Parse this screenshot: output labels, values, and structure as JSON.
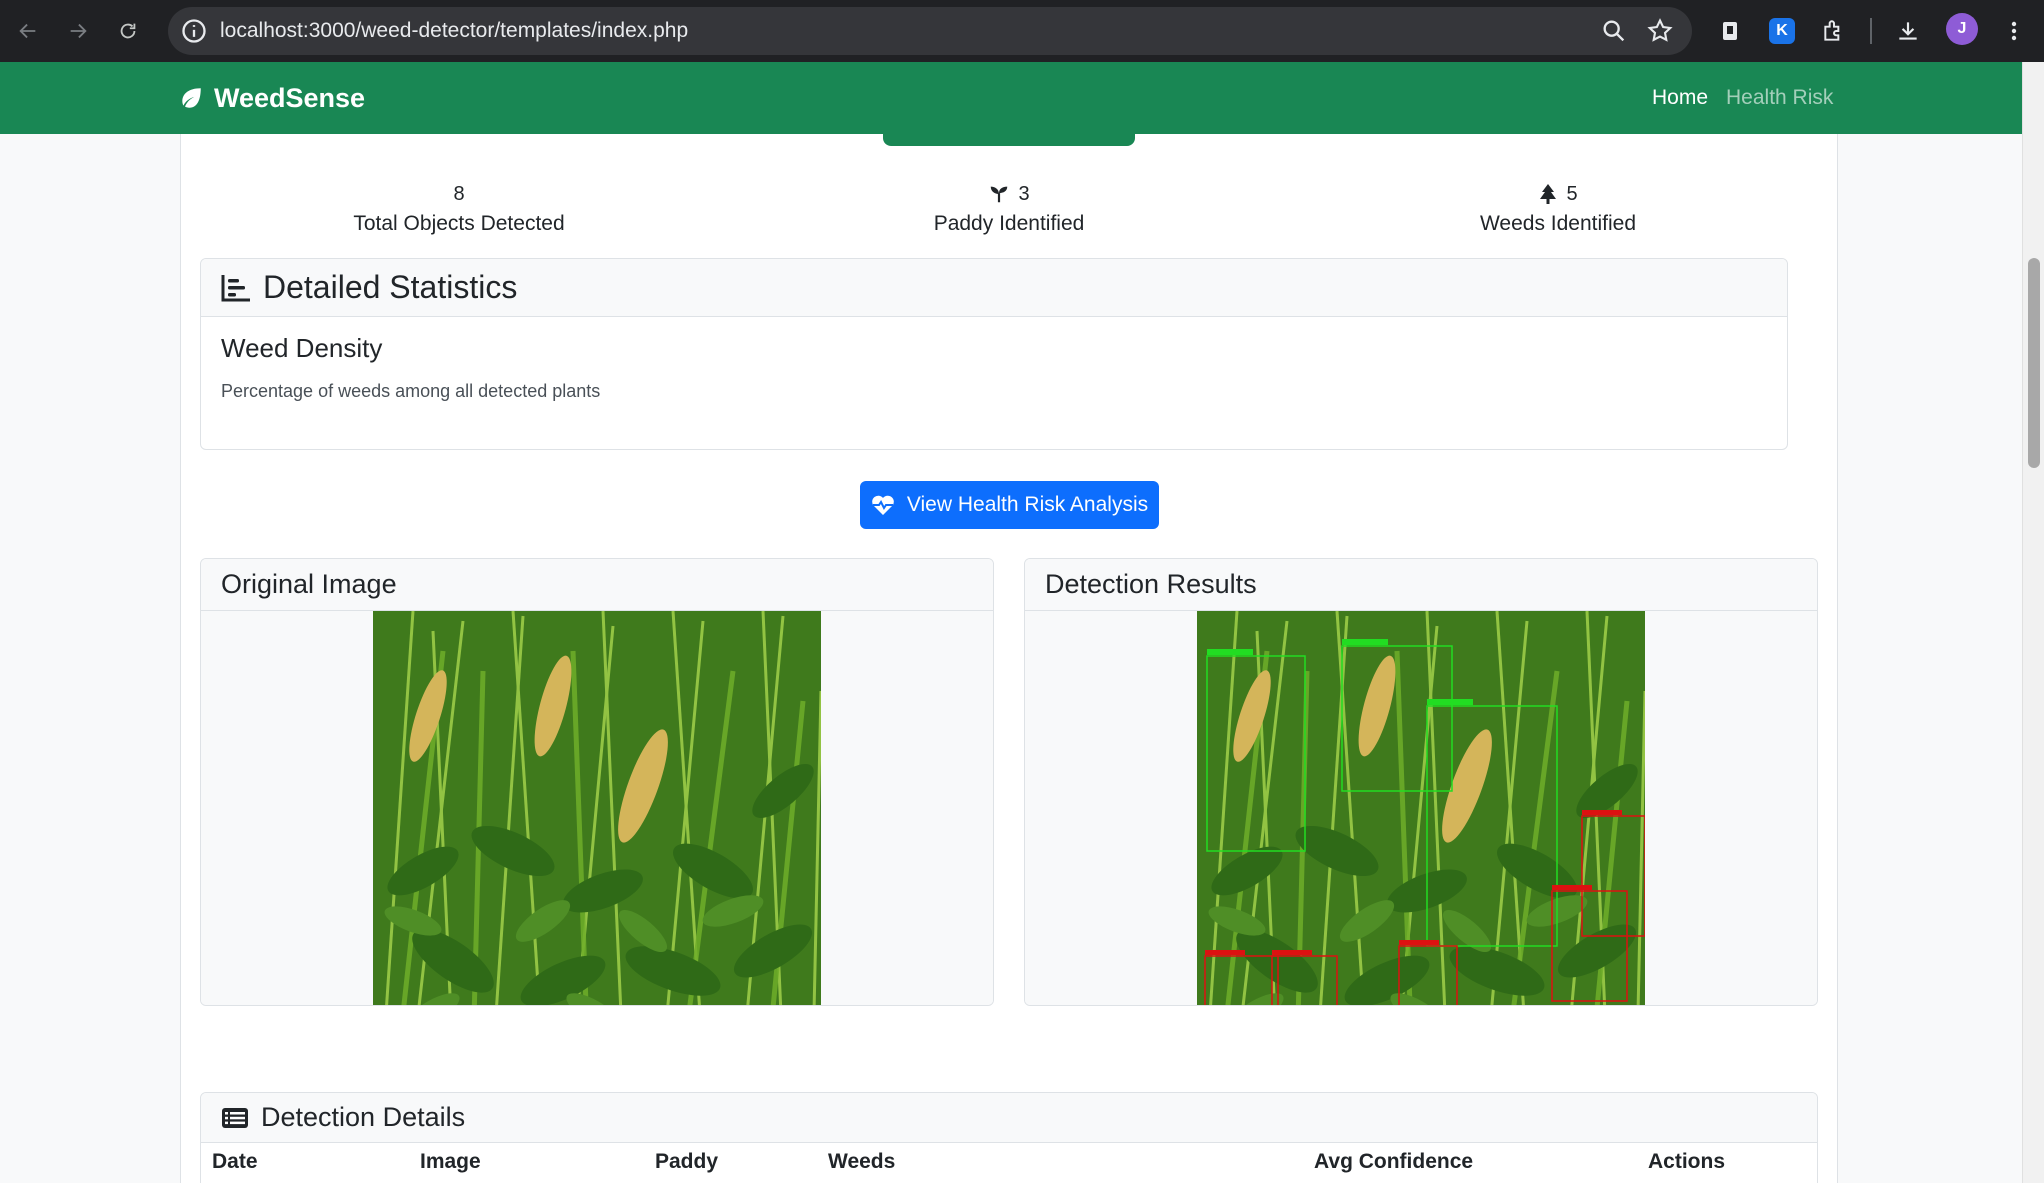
{
  "browser": {
    "url": "localhost:3000/weed-detector/templates/index.php",
    "avatar_letter": "J",
    "extension_badge": "K"
  },
  "navbar": {
    "brand": "WeedSense",
    "links": [
      "Home",
      "Health Risk"
    ]
  },
  "summary": {
    "total_value": "8",
    "total_label": "Total Objects Detected",
    "paddy_value": "3",
    "paddy_label": "Paddy Identified",
    "weeds_value": "5",
    "weeds_label": "Weeds Identified"
  },
  "stats": {
    "title": "Detailed Statistics",
    "density_title": "Weed Density",
    "density_desc": "Percentage of weeds among all detected plants"
  },
  "risk_button": "View Health Risk Analysis",
  "original_title": "Original Image",
  "detection_title": "Detection Results",
  "details": {
    "title": "Detection Details",
    "columns": [
      "Date",
      "Image",
      "Paddy",
      "Weeds",
      "Avg Confidence",
      "Actions"
    ]
  },
  "colors": {
    "brand_green": "#198754",
    "primary_blue": "#0d6efd",
    "paddy_box": "#22dd22",
    "weed_box": "#dd1111"
  }
}
